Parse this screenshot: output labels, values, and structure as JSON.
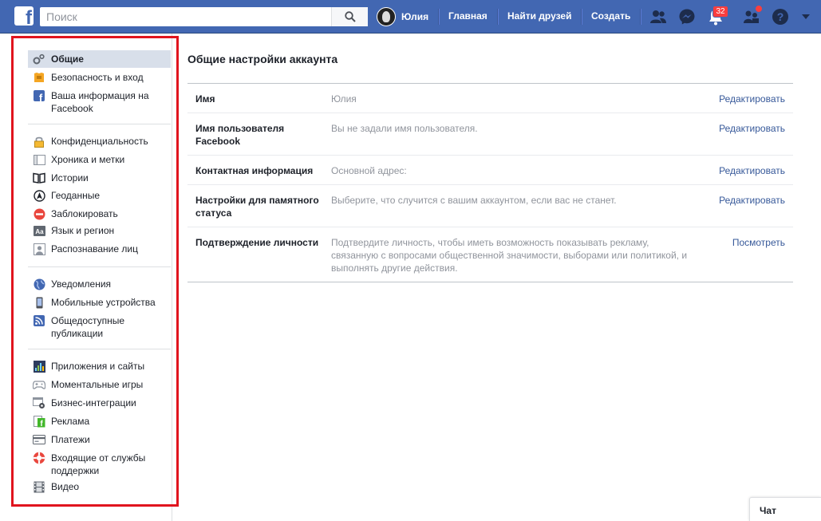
{
  "topbar": {
    "search_placeholder": "Поиск",
    "profile_name": "Юлия",
    "nav": [
      "Главная",
      "Найти друзей",
      "Создать"
    ],
    "notifications_count": "32",
    "icons": [
      "friend-requests-icon",
      "messenger-icon",
      "notifications-icon",
      "quick-help-icon",
      "help-icon"
    ]
  },
  "sidebar": {
    "groups": [
      [
        {
          "label": "Общие",
          "icon": "gears-icon",
          "active": true
        },
        {
          "label": "Безопасность и вход",
          "icon": "badge-icon"
        },
        {
          "label": "Ваша информация на Facebook",
          "icon": "facebook-icon"
        }
      ],
      [
        {
          "label": "Конфиденциальность",
          "icon": "lock-icon"
        },
        {
          "label": "Хроника и метки",
          "icon": "timeline-icon"
        },
        {
          "label": "Истории",
          "icon": "book-icon"
        },
        {
          "label": "Геоданные",
          "icon": "location-icon"
        },
        {
          "label": "Заблокировать",
          "icon": "block-icon"
        },
        {
          "label": "Язык и регион",
          "icon": "language-icon"
        },
        {
          "label": "Распознавание лиц",
          "icon": "face-icon"
        }
      ],
      [
        {
          "label": "Уведомления",
          "icon": "globe-icon"
        },
        {
          "label": "Мобильные устройства",
          "icon": "mobile-icon"
        },
        {
          "label": "Общедоступные публикации",
          "icon": "rss-icon"
        }
      ],
      [
        {
          "label": "Приложения и сайты",
          "icon": "apps-icon"
        },
        {
          "label": "Моментальные игры",
          "icon": "gamepad-icon"
        },
        {
          "label": "Бизнес-интеграции",
          "icon": "business-icon"
        },
        {
          "label": "Реклама",
          "icon": "ads-icon"
        },
        {
          "label": "Платежи",
          "icon": "card-icon"
        },
        {
          "label": "Входящие от службы поддержки",
          "icon": "lifebuoy-icon"
        },
        {
          "label": "Видео",
          "icon": "film-icon"
        }
      ]
    ]
  },
  "main": {
    "title": "Общие настройки аккаунта",
    "rows": [
      {
        "label": "Имя",
        "value": "Юлия",
        "action": "Редактировать"
      },
      {
        "label": "Имя пользователя Facebook",
        "value": "Вы не задали имя пользователя.",
        "action": "Редактировать"
      },
      {
        "label": "Контактная информация",
        "value": "Основной адрес:",
        "action": "Редактировать"
      },
      {
        "label": "Настройки для памятного статуса",
        "value": "Выберите, что случится с вашим аккаунтом, если вас не станет.",
        "action": "Редактировать"
      },
      {
        "label": "Подтверждение личности",
        "value": "Подтвердите личность, чтобы иметь возможность показывать рекламу, связанную с вопросами общественной значимости, выборами или политикой, и выполнять другие действия.",
        "action": "Посмотреть"
      }
    ]
  },
  "chat": {
    "label": "Чат"
  },
  "colors": {
    "brand": "#4267b2",
    "link": "#365899",
    "highlight_border": "#e0141e",
    "active_bg": "#d8dfea"
  }
}
